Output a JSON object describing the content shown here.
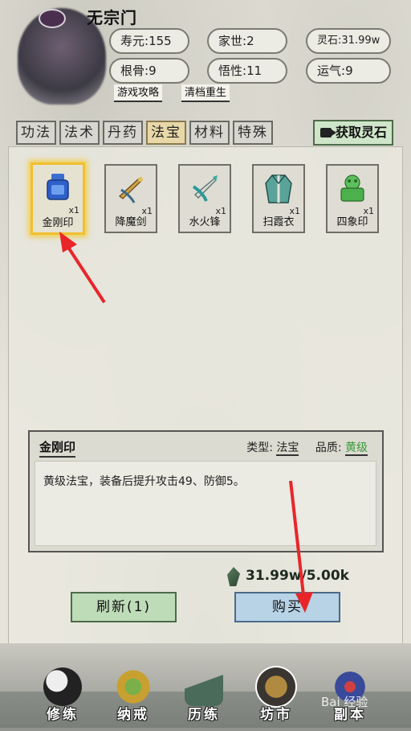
{
  "header": {
    "sect_name": "无宗门",
    "stats": [
      {
        "label": "寿元",
        "value": "155"
      },
      {
        "label": "家世",
        "value": "2"
      },
      {
        "label": "灵石",
        "value": "31.99w"
      },
      {
        "label": "根骨",
        "value": "9"
      },
      {
        "label": "悟性",
        "value": "11"
      },
      {
        "label": "运气",
        "value": "9"
      }
    ],
    "stat_separator": ":",
    "links": {
      "guide": "游戏攻略",
      "reset": "清档重生"
    }
  },
  "tabs": [
    {
      "label": "功法"
    },
    {
      "label": "法术"
    },
    {
      "label": "丹药"
    },
    {
      "label": "法宝",
      "active": true
    },
    {
      "label": "材料"
    },
    {
      "label": "特殊"
    }
  ],
  "get_stone_button": "获取灵石",
  "items": [
    {
      "name": "金刚印",
      "count": "x1",
      "icon": "blue-seal-icon",
      "selected": true
    },
    {
      "name": "降魔剑",
      "count": "x1",
      "icon": "gold-sword-icon"
    },
    {
      "name": "水火锋",
      "count": "x1",
      "icon": "jade-sword-icon"
    },
    {
      "name": "扫霞衣",
      "count": "x1",
      "icon": "robe-icon"
    },
    {
      "name": "四象印",
      "count": "x1",
      "icon": "green-seal-icon"
    }
  ],
  "detail": {
    "name": "金刚印",
    "type_label": "类型:",
    "type_value": "法宝",
    "quality_label": "品质:",
    "quality_value": "黄级",
    "description": "黄级法宝，装备后提升攻击49、防御5。"
  },
  "price": {
    "owned": "31.99w",
    "separator": "/",
    "cost": "5.00k"
  },
  "buttons": {
    "refresh": "刷新(1)",
    "buy": "购买"
  },
  "nav": [
    {
      "label": "修练",
      "icon": "taiji-icon"
    },
    {
      "label": "纳戒",
      "icon": "ring-icon"
    },
    {
      "label": "历练",
      "icon": "mountain-icon"
    },
    {
      "label": "坊市",
      "icon": "cauldron-icon",
      "active": true
    },
    {
      "label": "副本",
      "icon": "pagoda-icon"
    }
  ],
  "watermark": "Bai 经验",
  "colors": {
    "selected_glow": "#f0c030",
    "grade_green": "#3a9a3a",
    "arrow_red": "#e8262a"
  }
}
